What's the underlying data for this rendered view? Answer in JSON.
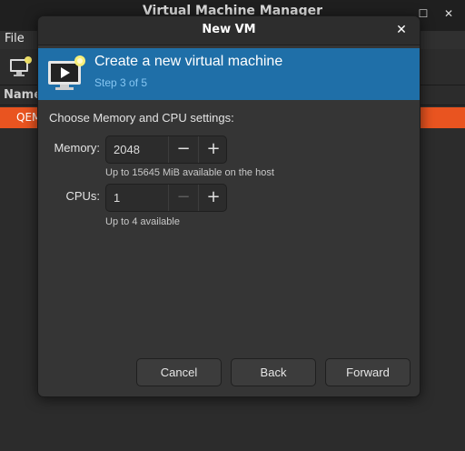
{
  "main_window": {
    "title": "Virtual Machine Manager",
    "menu": {
      "file_label": "File"
    },
    "column_header": "Name",
    "vm_row_label": "QEMU"
  },
  "dialog": {
    "title": "New VM",
    "close_icon": "close-icon",
    "banner": {
      "title": "Create a new virtual machine",
      "step": "Step 3 of 5",
      "icon": "monitor-play-icon",
      "color": "#1f6fa8"
    },
    "section_heading": "Choose Memory and CPU settings:",
    "memory": {
      "label": "Memory:",
      "value": "2048",
      "decrement": "−",
      "increment": "+",
      "hint": "Up to 15645 MiB available on the host"
    },
    "cpus": {
      "label": "CPUs:",
      "value": "1",
      "decrement": "−",
      "increment": "+",
      "hint": "Up to 4 available"
    },
    "buttons": {
      "cancel": "Cancel",
      "back": "Back",
      "forward": "Forward"
    }
  },
  "colors": {
    "accent_row": "#e95420",
    "banner": "#1f6fa8",
    "step_text": "#86c6f2"
  }
}
